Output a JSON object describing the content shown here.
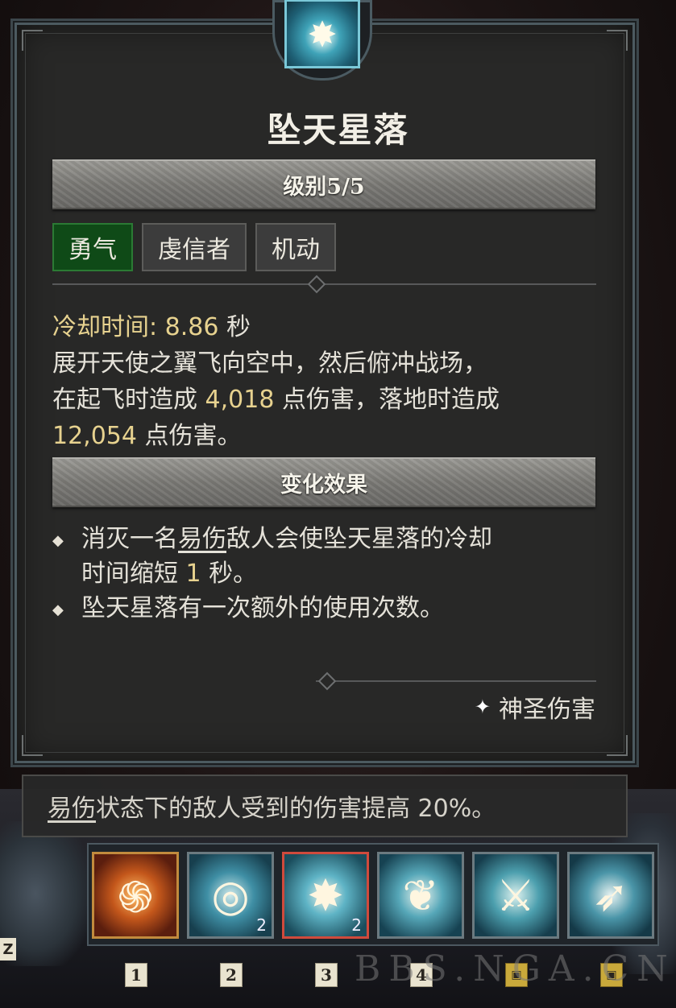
{
  "skill": {
    "title": "坠天星落",
    "level": "级别5/5",
    "tags": [
      "勇气",
      "虔信者",
      "机动"
    ],
    "cooldown_label": "冷却时间: ",
    "cooldown_value": "8.86",
    "cooldown_unit": " 秒",
    "desc_line1": "展开天使之翼飞向空中，然后俯冲战场，",
    "desc_line2a": "在起飞时造成 ",
    "takeoff_damage": "4,018",
    "desc_line2b": " 点伤害，落地时造成",
    "landing_damage": "12,054",
    "desc_line3": " 点伤害。",
    "modifier_header": "变化效果",
    "bullet1_a": "消灭一名",
    "bullet1_keyword": "易伤",
    "bullet1_b": "敌人会使坠天星落的冷却",
    "bullet1_c": "时间缩短 ",
    "bullet1_value": "1",
    "bullet1_d": " 秒。",
    "bullet2": "坠天星落有一次额外的使用次数。",
    "damage_type": "神圣伤害"
  },
  "hint": {
    "keyword": "易伤",
    "text": "状态下的敌人受到的伤害提高 20%。"
  },
  "skill_bar": {
    "slots": [
      {
        "icon": "sun-swirl-icon",
        "charge": ""
      },
      {
        "icon": "holy-ring-icon",
        "charge": "2"
      },
      {
        "icon": "falling-star-icon",
        "charge": "2"
      },
      {
        "icon": "angel-wings-icon",
        "charge": ""
      },
      {
        "icon": "sword-arc-icon",
        "charge": ""
      },
      {
        "icon": "spear-icon",
        "charge": ""
      }
    ],
    "keys": [
      "1",
      "2",
      "3",
      "4"
    ],
    "z_key": "Z"
  },
  "watermark": "BBS.NGA.CN",
  "colors": {
    "accent_gold": "#e7d28f",
    "tag_active": "#0f4a17",
    "panel": "#282827"
  }
}
